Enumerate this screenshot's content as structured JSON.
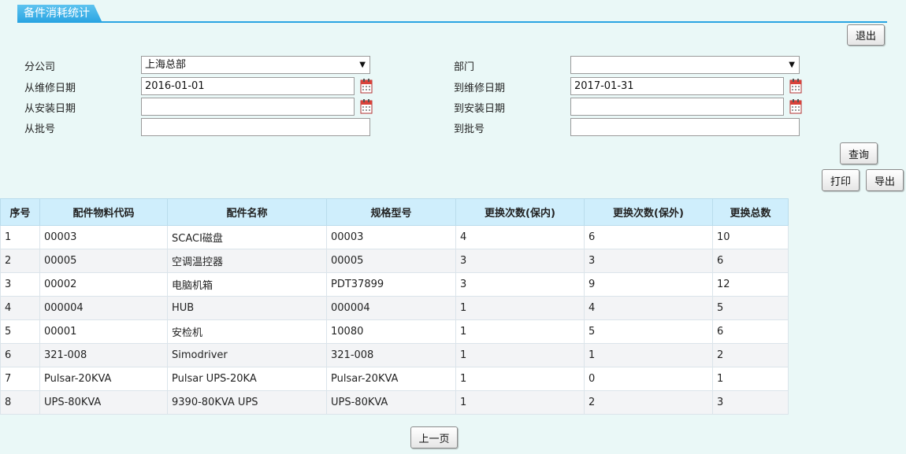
{
  "page": {
    "title": "备件消耗统计"
  },
  "buttons": {
    "exit": "退出",
    "query": "查询",
    "print": "打印",
    "export": "导出",
    "prev_page": "上一页"
  },
  "filters": {
    "branch_label": "分公司",
    "branch_value": "上海总部",
    "dept_label": "部门",
    "dept_value": "",
    "repair_from_label": "从维修日期",
    "repair_from_value": "2016-01-01",
    "repair_to_label": "到维修日期",
    "repair_to_value": "2017-01-31",
    "install_from_label": "从安装日期",
    "install_from_value": "",
    "install_to_label": "到安装日期",
    "install_to_value": "",
    "batch_from_label": "从批号",
    "batch_from_value": "",
    "batch_to_label": "到批号",
    "batch_to_value": ""
  },
  "table": {
    "headers": [
      "序号",
      "配件物料代码",
      "配件名称",
      "规格型号",
      "更换次数(保内)",
      "更换次数(保外)",
      "更换总数"
    ],
    "rows": [
      [
        "1",
        "00003",
        "SCACI磁盘",
        "00003",
        "4",
        "6",
        "10"
      ],
      [
        "2",
        "00005",
        "空调温控器",
        "00005",
        "3",
        "3",
        "6"
      ],
      [
        "3",
        "00002",
        "电脑机箱",
        "PDT37899",
        "3",
        "9",
        "12"
      ],
      [
        "4",
        "000004",
        "HUB",
        "000004",
        "1",
        "4",
        "5"
      ],
      [
        "5",
        "00001",
        "安检机",
        "10080",
        "1",
        "5",
        "6"
      ],
      [
        "6",
        "321-008",
        "Simodriver",
        "321-008",
        "1",
        "1",
        "2"
      ],
      [
        "7",
        "Pulsar-20KVA",
        "Pulsar UPS-20KA",
        "Pulsar-20KVA",
        "1",
        "0",
        "1"
      ],
      [
        "8",
        "UPS-80KVA",
        "9390-80KVA UPS",
        "UPS-80KVA",
        "1",
        "2",
        "3"
      ]
    ]
  },
  "colors": {
    "accent": "#29a4e2",
    "header_bg": "#cfeefc",
    "page_bg": "#eaf8f7"
  },
  "icons": {
    "calendar": "calendar-icon",
    "dropdown": "chevron-down-icon"
  }
}
